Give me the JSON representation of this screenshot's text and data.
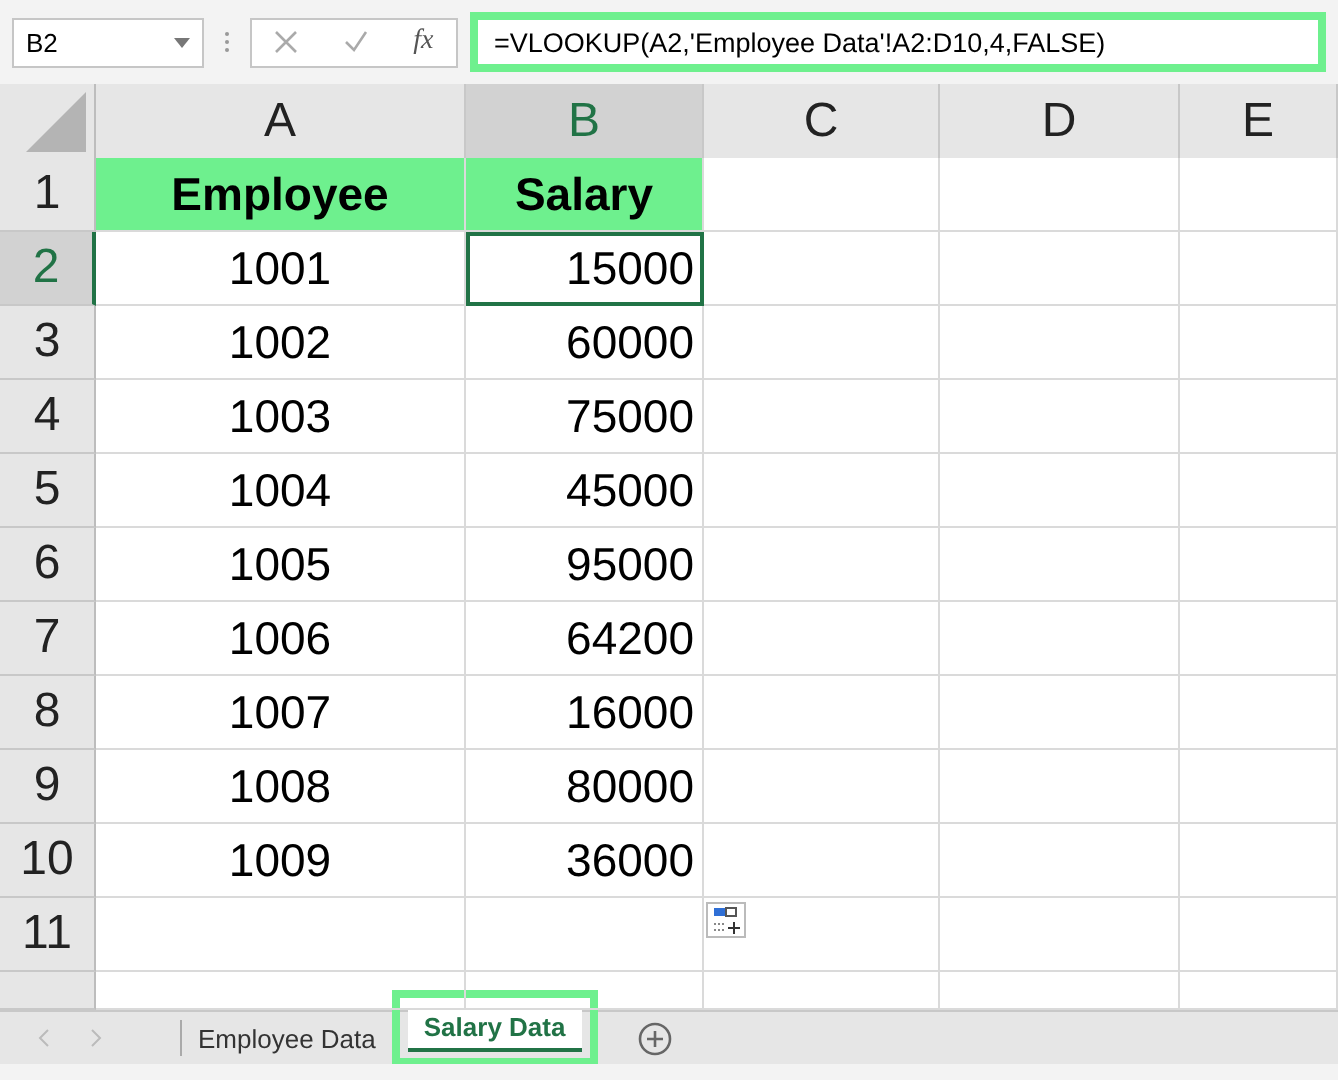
{
  "name_box": {
    "value": "B2"
  },
  "formula_bar": {
    "function_label": "fx",
    "value": "=VLOOKUP(A2,'Employee Data'!A2:D10,4,FALSE)",
    "highlighted": true
  },
  "columns": [
    {
      "label": "A",
      "selected": false
    },
    {
      "label": "B",
      "selected": true
    },
    {
      "label": "C",
      "selected": false
    },
    {
      "label": "D",
      "selected": false
    },
    {
      "label": "E",
      "selected": false
    }
  ],
  "rows": [
    {
      "label": "1",
      "selected": false,
      "cells": [
        {
          "text": "Employee",
          "kind": "header",
          "selected": false
        },
        {
          "text": "Salary",
          "kind": "header",
          "selected": false
        }
      ]
    },
    {
      "label": "2",
      "selected": true,
      "cells": [
        {
          "text": "1001",
          "kind": "text",
          "selected": false
        },
        {
          "text": "15000",
          "kind": "number",
          "selected": true
        }
      ]
    },
    {
      "label": "3",
      "selected": false,
      "cells": [
        {
          "text": "1002",
          "kind": "text",
          "selected": false
        },
        {
          "text": "60000",
          "kind": "number",
          "selected": false
        }
      ]
    },
    {
      "label": "4",
      "selected": false,
      "cells": [
        {
          "text": "1003",
          "kind": "text",
          "selected": false
        },
        {
          "text": "75000",
          "kind": "number",
          "selected": false
        }
      ]
    },
    {
      "label": "5",
      "selected": false,
      "cells": [
        {
          "text": "1004",
          "kind": "text",
          "selected": false
        },
        {
          "text": "45000",
          "kind": "number",
          "selected": false
        }
      ]
    },
    {
      "label": "6",
      "selected": false,
      "cells": [
        {
          "text": "1005",
          "kind": "text",
          "selected": false
        },
        {
          "text": "95000",
          "kind": "number",
          "selected": false
        }
      ]
    },
    {
      "label": "7",
      "selected": false,
      "cells": [
        {
          "text": "1006",
          "kind": "text",
          "selected": false
        },
        {
          "text": "64200",
          "kind": "number",
          "selected": false
        }
      ]
    },
    {
      "label": "8",
      "selected": false,
      "cells": [
        {
          "text": "1007",
          "kind": "text",
          "selected": false
        },
        {
          "text": "16000",
          "kind": "number",
          "selected": false
        }
      ]
    },
    {
      "label": "9",
      "selected": false,
      "cells": [
        {
          "text": "1008",
          "kind": "text",
          "selected": false
        },
        {
          "text": "80000",
          "kind": "number",
          "selected": false
        }
      ]
    },
    {
      "label": "10",
      "selected": false,
      "cells": [
        {
          "text": "1009",
          "kind": "text",
          "selected": false
        },
        {
          "text": "36000",
          "kind": "number",
          "selected": false
        }
      ]
    },
    {
      "label": "11",
      "selected": false,
      "cells": []
    },
    {
      "selected": false,
      "cells": []
    }
  ],
  "sheet_tabs": [
    {
      "label": "Employee Data",
      "selected": false,
      "highlighted": false
    },
    {
      "label": "Salary Data",
      "selected": true,
      "highlighted": true
    }
  ]
}
